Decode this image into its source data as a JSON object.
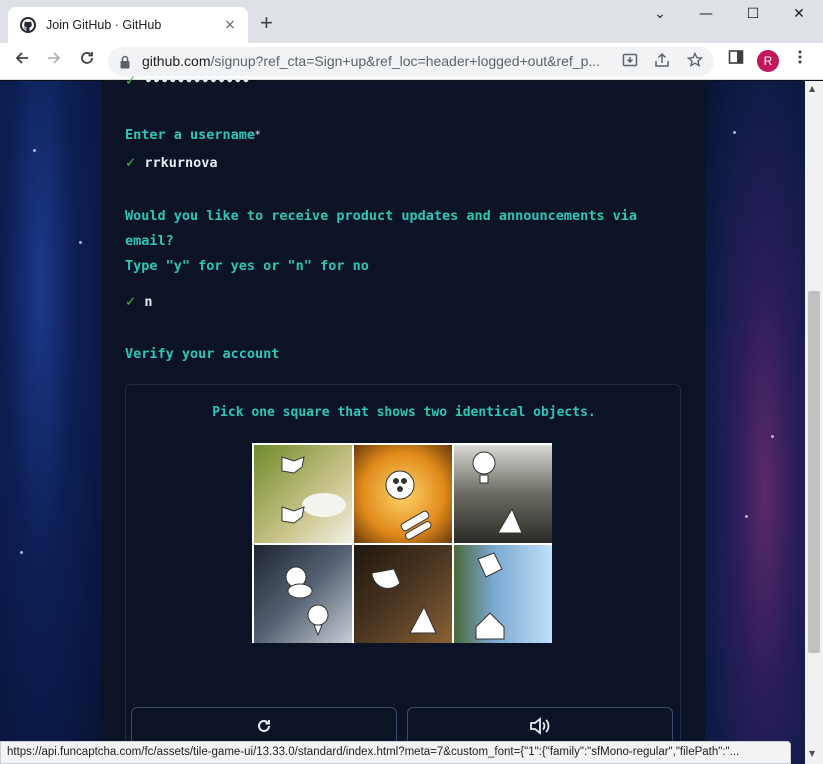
{
  "browser": {
    "tab_title": "Join GitHub · GitHub",
    "tab_close": "×",
    "new_tab": "+",
    "url_host": "github.com",
    "url_path": "/signup?ref_cta=Sign+up&ref_loc=header+logged+out&ref_p...",
    "profile_initial": "R",
    "window_controls": [
      "⌄",
      "—",
      "☐",
      "✕"
    ]
  },
  "form": {
    "password_masked": "•••••••••••••",
    "username_prompt": "Enter a username",
    "username_required": "*",
    "username_value": "rrkurnova",
    "updates_prompt_line1": "Would you like to receive product updates and announcements via",
    "updates_prompt_line2": "email?",
    "updates_prompt_line3": "Type \"y\" for yes or \"n\" for no",
    "updates_value": "n",
    "verify_prompt": "Verify your account",
    "check_mark": "✓"
  },
  "captcha": {
    "question": "Pick one square that shows two identical objects.",
    "tiles": [
      {
        "icon": "hand-icon",
        "selected": true
      },
      {
        "icon": "palette-icon",
        "selected": false
      },
      {
        "icon": "lamp-icon",
        "selected": false
      },
      {
        "icon": "raccoon-icon",
        "selected": false
      },
      {
        "icon": "mask-icon",
        "selected": false
      },
      {
        "icon": "jar-icon",
        "selected": false
      }
    ],
    "refresh_icon": "refresh-icon",
    "audio_icon": "audio-icon"
  },
  "status_bar": {
    "text": "https://api.funcaptcha.com/fc/assets/tile-game-ui/13.33.0/standard/index.html?meta=7&custom_font={\"1\":{\"family\":\"sfMono-regular\",\"filePath\":\"..."
  },
  "colors": {
    "prompt": "#2dc7b5",
    "check": "#3fb950",
    "page_bg": "#0c1326"
  }
}
